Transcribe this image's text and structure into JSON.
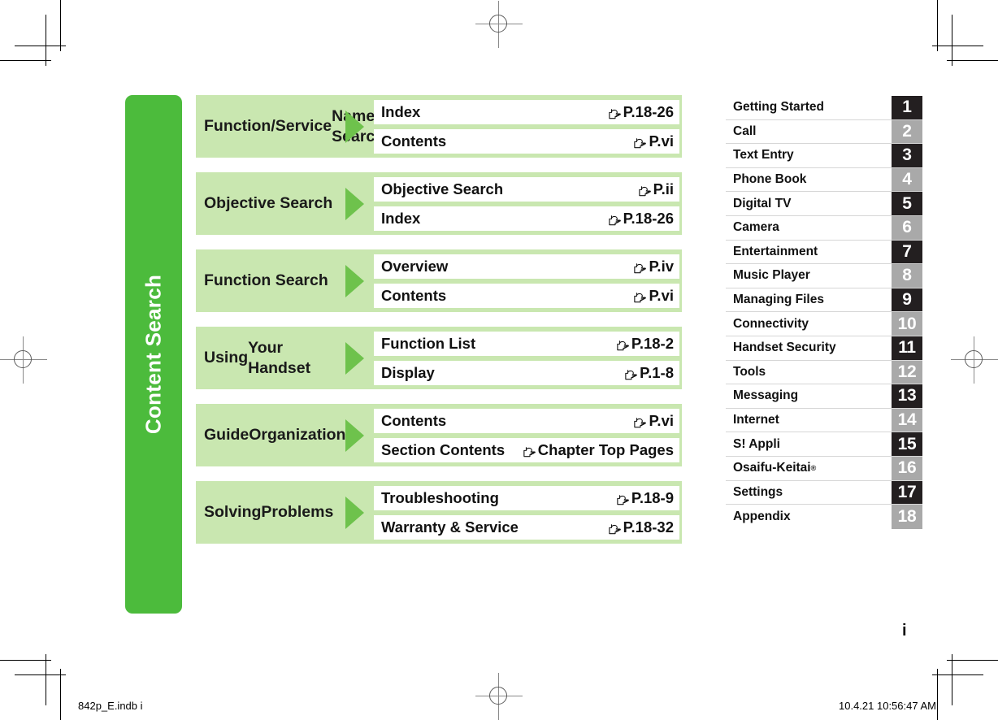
{
  "document": {
    "folio": "i",
    "side_tab_label": "Content Search"
  },
  "search_blocks": [
    {
      "title_lines": [
        "Function/Service",
        "Name Search"
      ],
      "rows": [
        {
          "label": "Index",
          "icon": "pointing-hand-icon",
          "ref": "P.18-26"
        },
        {
          "label": "Contents",
          "icon": "pointing-hand-icon",
          "ref": "P.vi"
        }
      ]
    },
    {
      "title_lines": [
        "Objective Search"
      ],
      "rows": [
        {
          "label": "Objective Search",
          "icon": "pointing-hand-icon",
          "ref": "P.ii"
        },
        {
          "label": "Index",
          "icon": "pointing-hand-icon",
          "ref": "P.18-26"
        }
      ]
    },
    {
      "title_lines": [
        "Function Search"
      ],
      "rows": [
        {
          "label": "Overview",
          "icon": "pointing-hand-icon",
          "ref": "P.iv"
        },
        {
          "label": "Contents",
          "icon": "pointing-hand-icon",
          "ref": "P.vi"
        }
      ]
    },
    {
      "title_lines": [
        "Using",
        "Your Handset"
      ],
      "rows": [
        {
          "label": "Function List",
          "icon": "pointing-hand-icon",
          "ref": "P.18-2"
        },
        {
          "label": "Display",
          "icon": "pointing-hand-icon",
          "ref": "P.1-8"
        }
      ]
    },
    {
      "title_lines": [
        "Guide",
        "Organization"
      ],
      "rows": [
        {
          "label": "Contents",
          "icon": "pointing-hand-icon",
          "ref": "P.vi"
        },
        {
          "label": "Section Contents",
          "icon": "pointing-hand-icon",
          "ref": "Chapter Top Pages"
        }
      ]
    },
    {
      "title_lines": [
        "Solving",
        "Problems"
      ],
      "rows": [
        {
          "label": "Troubleshooting",
          "icon": "pointing-hand-icon",
          "ref": "P.18-9"
        },
        {
          "label": "Warranty & Service",
          "icon": "pointing-hand-icon",
          "ref": "P.18-32"
        }
      ]
    }
  ],
  "chapters": [
    {
      "name": "Getting Started",
      "number": "1",
      "style": "dark"
    },
    {
      "name": "Call",
      "number": "2",
      "style": "light"
    },
    {
      "name": "Text Entry",
      "number": "3",
      "style": "dark"
    },
    {
      "name": "Phone Book",
      "number": "4",
      "style": "light"
    },
    {
      "name": "Digital TV",
      "number": "5",
      "style": "dark"
    },
    {
      "name": "Camera",
      "number": "6",
      "style": "light"
    },
    {
      "name": "Entertainment",
      "number": "7",
      "style": "dark"
    },
    {
      "name": "Music Player",
      "number": "8",
      "style": "light"
    },
    {
      "name": "Managing Files",
      "number": "9",
      "style": "dark"
    },
    {
      "name": "Connectivity",
      "number": "10",
      "style": "light"
    },
    {
      "name": "Handset Security",
      "number": "11",
      "style": "dark"
    },
    {
      "name": "Tools",
      "number": "12",
      "style": "light"
    },
    {
      "name": "Messaging",
      "number": "13",
      "style": "dark"
    },
    {
      "name": "Internet",
      "number": "14",
      "style": "light"
    },
    {
      "name": "S! Appli",
      "number": "15",
      "style": "dark"
    },
    {
      "name": "Osaifu-Keitai",
      "number": "16",
      "style": "light",
      "superscript": "®"
    },
    {
      "name": "Settings",
      "number": "17",
      "style": "dark"
    },
    {
      "name": "Appendix",
      "number": "18",
      "style": "light"
    }
  ],
  "footer": {
    "file_slug": "842p_E.indb   i",
    "timestamp": "10.4.21   10:56:47 AM"
  },
  "colors": {
    "tab_green": "#4cbb3c",
    "block_green": "#c9e7b0",
    "arrow_green": "#6ec24c",
    "chapter_dark": "#231f20",
    "chapter_light": "#a9a9a9"
  }
}
